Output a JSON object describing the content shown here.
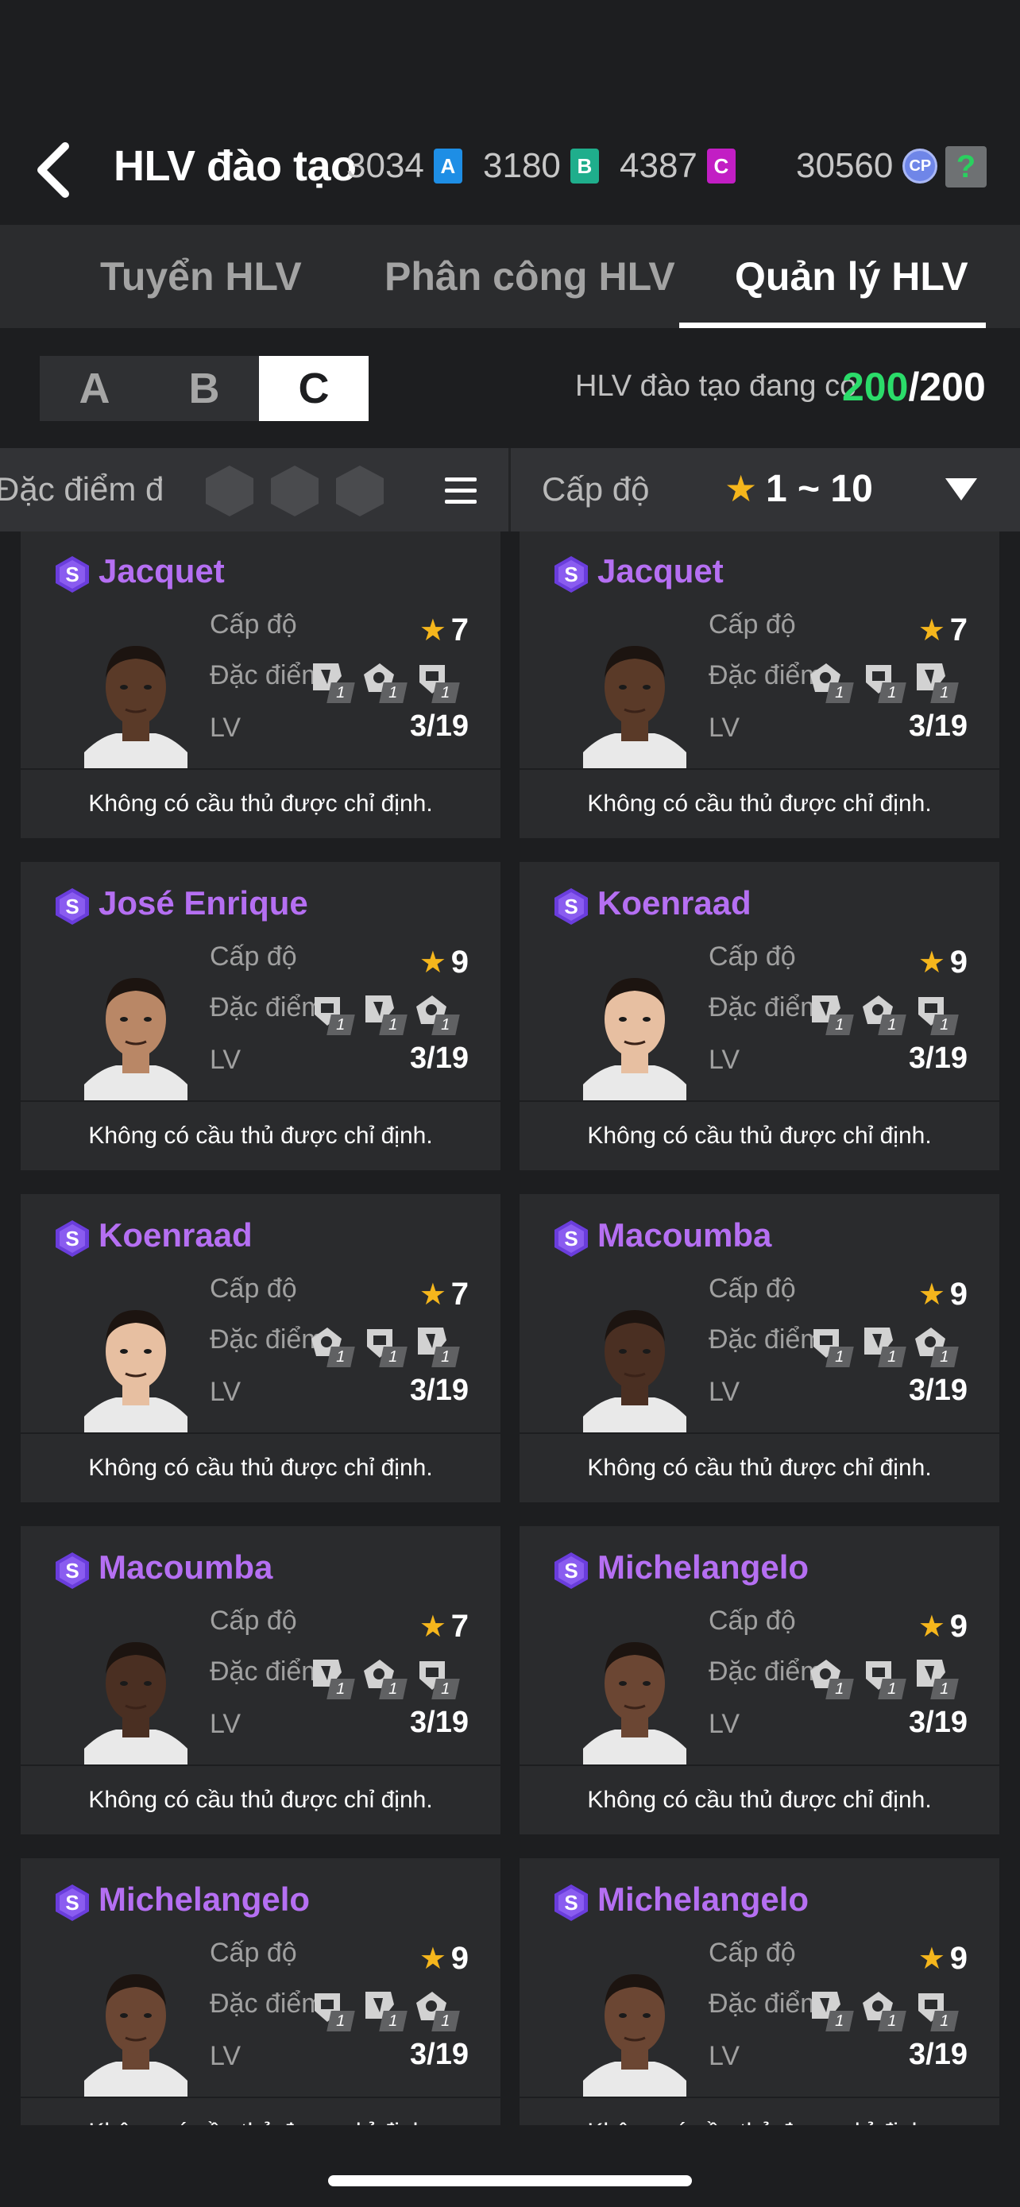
{
  "header": {
    "title": "HLV đào tạo",
    "currencies": [
      {
        "value": "3034",
        "icon": "A"
      },
      {
        "value": "3180",
        "icon": "B"
      },
      {
        "value": "4387",
        "icon": "C"
      }
    ],
    "cp_value": "30560",
    "cp_icon": "CP",
    "help_label": "?"
  },
  "tabs": [
    {
      "label": "Tuyển HLV",
      "active": false
    },
    {
      "label": "Phân công HLV",
      "active": false
    },
    {
      "label": "Quản lý HLV",
      "active": true
    }
  ],
  "grade_tabs": [
    {
      "label": "A",
      "selected": false
    },
    {
      "label": "B",
      "selected": false
    },
    {
      "label": "C",
      "selected": true
    }
  ],
  "count": {
    "label": "HLV đào tạo đang có",
    "current": "200",
    "max": "/200"
  },
  "filter": {
    "trait_label": "Đặc điểm đà",
    "level_label": "Cấp độ",
    "level_range": "1 ~ 10"
  },
  "card_labels": {
    "level": "Cấp độ",
    "traits": "Đặc điểm",
    "lv": "LV",
    "empty": "Không có cầu thủ được chỉ định."
  },
  "cards": [
    {
      "name": "Jacquet",
      "level": "7",
      "lv": "3/19",
      "skin": "#5a3a28"
    },
    {
      "name": "Jacquet",
      "level": "7",
      "lv": "3/19",
      "skin": "#5a3a28"
    },
    {
      "name": "José Enrique",
      "level": "9",
      "lv": "3/19",
      "skin": "#b98766"
    },
    {
      "name": "Koenraad",
      "level": "9",
      "lv": "3/19",
      "skin": "#e7bfa1"
    },
    {
      "name": "Koenraad",
      "level": "7",
      "lv": "3/19",
      "skin": "#e7bfa1"
    },
    {
      "name": "Macoumba",
      "level": "9",
      "lv": "3/19",
      "skin": "#4a2f22"
    },
    {
      "name": "Macoumba",
      "level": "7",
      "lv": "3/19",
      "skin": "#4a2f22"
    },
    {
      "name": "Michelangelo",
      "level": "9",
      "lv": "3/19",
      "skin": "#6b4633"
    },
    {
      "name": "Michelangelo",
      "level": "9",
      "lv": "3/19",
      "skin": "#6b4633"
    },
    {
      "name": "Michelangelo",
      "level": "9",
      "lv": "3/19",
      "skin": "#6b4633"
    }
  ],
  "trait_badge": "1",
  "colors": {
    "accent_green": "#2bdc6a",
    "name_purple": "#b56ff2",
    "star": "#f5b61c"
  }
}
